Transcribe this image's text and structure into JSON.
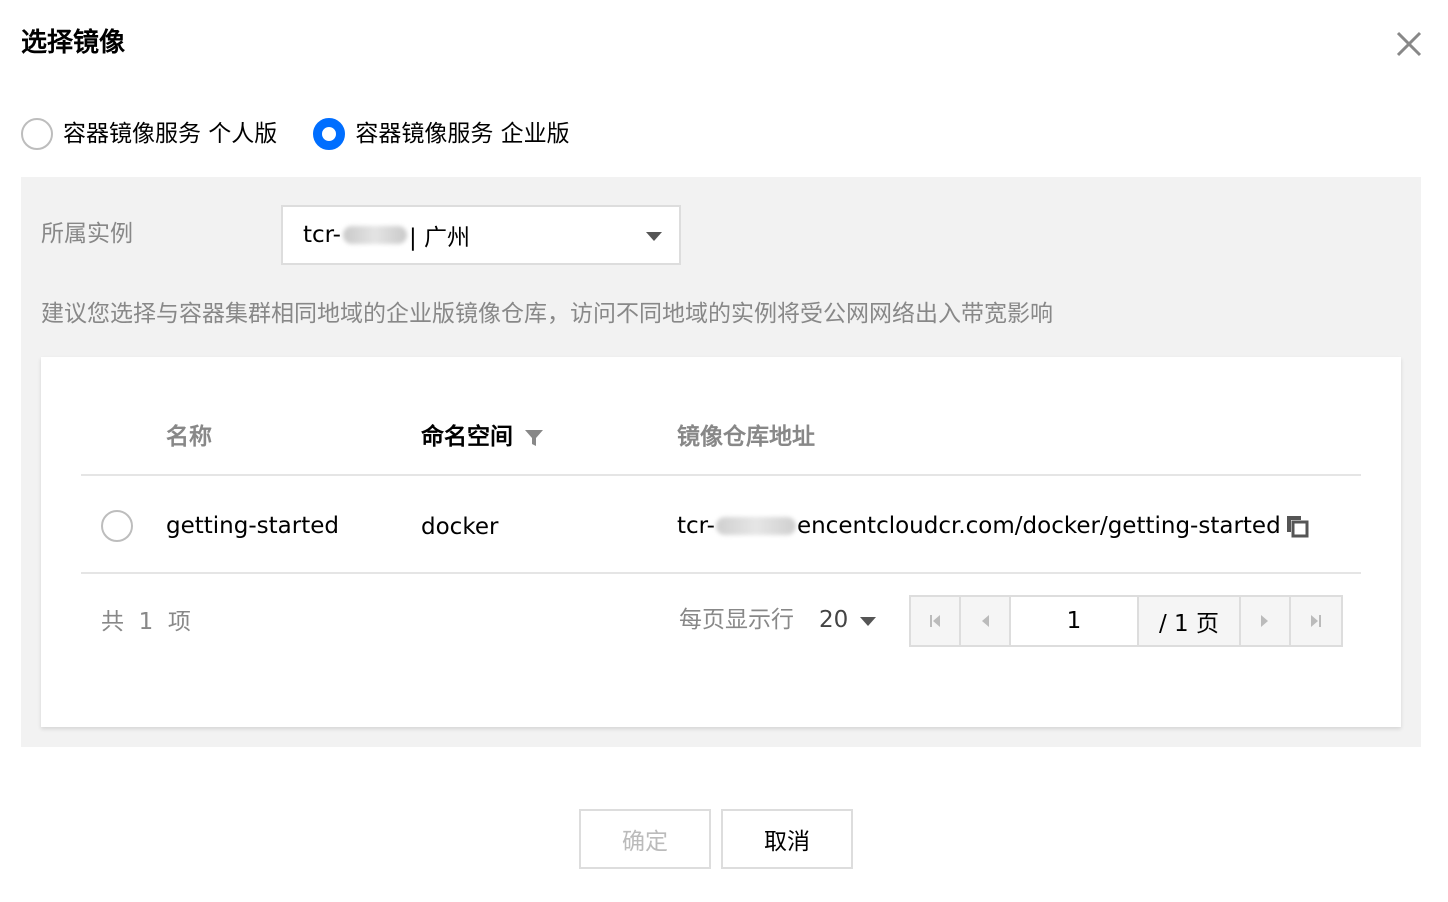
{
  "dialog": {
    "title": "选择镜像"
  },
  "registry_type": {
    "options": [
      {
        "label": "容器镜像服务 个人版",
        "checked": false
      },
      {
        "label": "容器镜像服务 企业版",
        "checked": true
      }
    ]
  },
  "instance": {
    "label": "所属实例",
    "value_prefix": "tcr-",
    "value_suffix": "| 广州"
  },
  "hint": "建议您选择与容器集群相同地域的企业版镜像仓库，访问不同地域的实例将受公网网络出入带宽影响",
  "table": {
    "columns": {
      "name": "名称",
      "namespace": "命名空间",
      "address": "镜像仓库地址"
    },
    "rows": [
      {
        "name": "getting-started",
        "namespace": "docker",
        "address_prefix": "tcr-",
        "address_suffix": "encentcloudcr.com/docker/getting-started",
        "selected": false
      }
    ]
  },
  "pagination": {
    "total_text": "共  1  项",
    "per_page_label": "每页显示行",
    "per_page_value": "20",
    "current_page": "1",
    "total_pages_text": "/ 1 页"
  },
  "footer": {
    "ok_label": "确定",
    "cancel_label": "取消"
  },
  "colors": {
    "accent": "#006eff",
    "panel_bg": "#f2f2f2",
    "muted_text": "#888888"
  },
  "icons": {
    "close": "close-icon",
    "filter": "filter-icon",
    "copy": "copy-icon",
    "first_page": "first-page-icon",
    "prev_page": "prev-page-icon",
    "next_page": "next-page-icon",
    "last_page": "last-page-icon"
  }
}
